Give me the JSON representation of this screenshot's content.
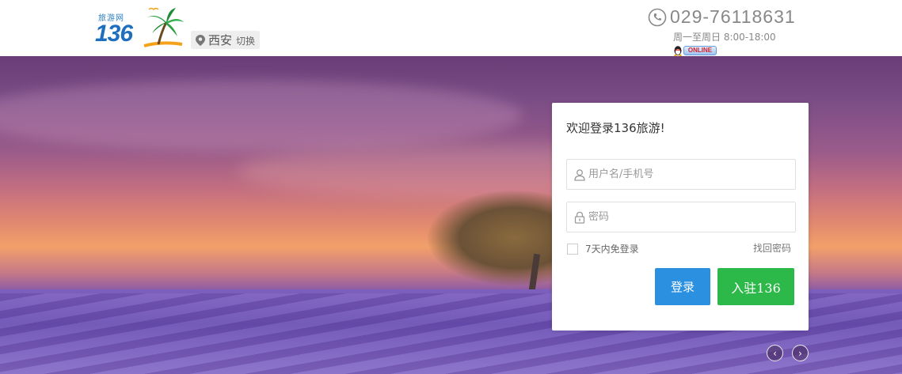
{
  "header": {
    "logo": {
      "small_text": "旅游网",
      "number": "136"
    },
    "city": {
      "name": "西安",
      "switch_label": "切换"
    },
    "contact": {
      "phone": "029-76118631",
      "hours": "周一至周日 8:00-18:00",
      "qq_badge": "ONLINE"
    }
  },
  "login": {
    "welcome": "欢迎登录136旅游!",
    "username_placeholder": "用户名/手机号",
    "password_placeholder": "密码",
    "remember_label": "7天内免登录",
    "forgot_label": "找回密码",
    "login_button": "登录",
    "join_button": "入驻136"
  },
  "carousel": {
    "prev": "‹",
    "next": "›"
  },
  "colors": {
    "login_button": "#2b90e0",
    "join_button": "#2db84a",
    "logo_blue": "#1f6fbf"
  }
}
